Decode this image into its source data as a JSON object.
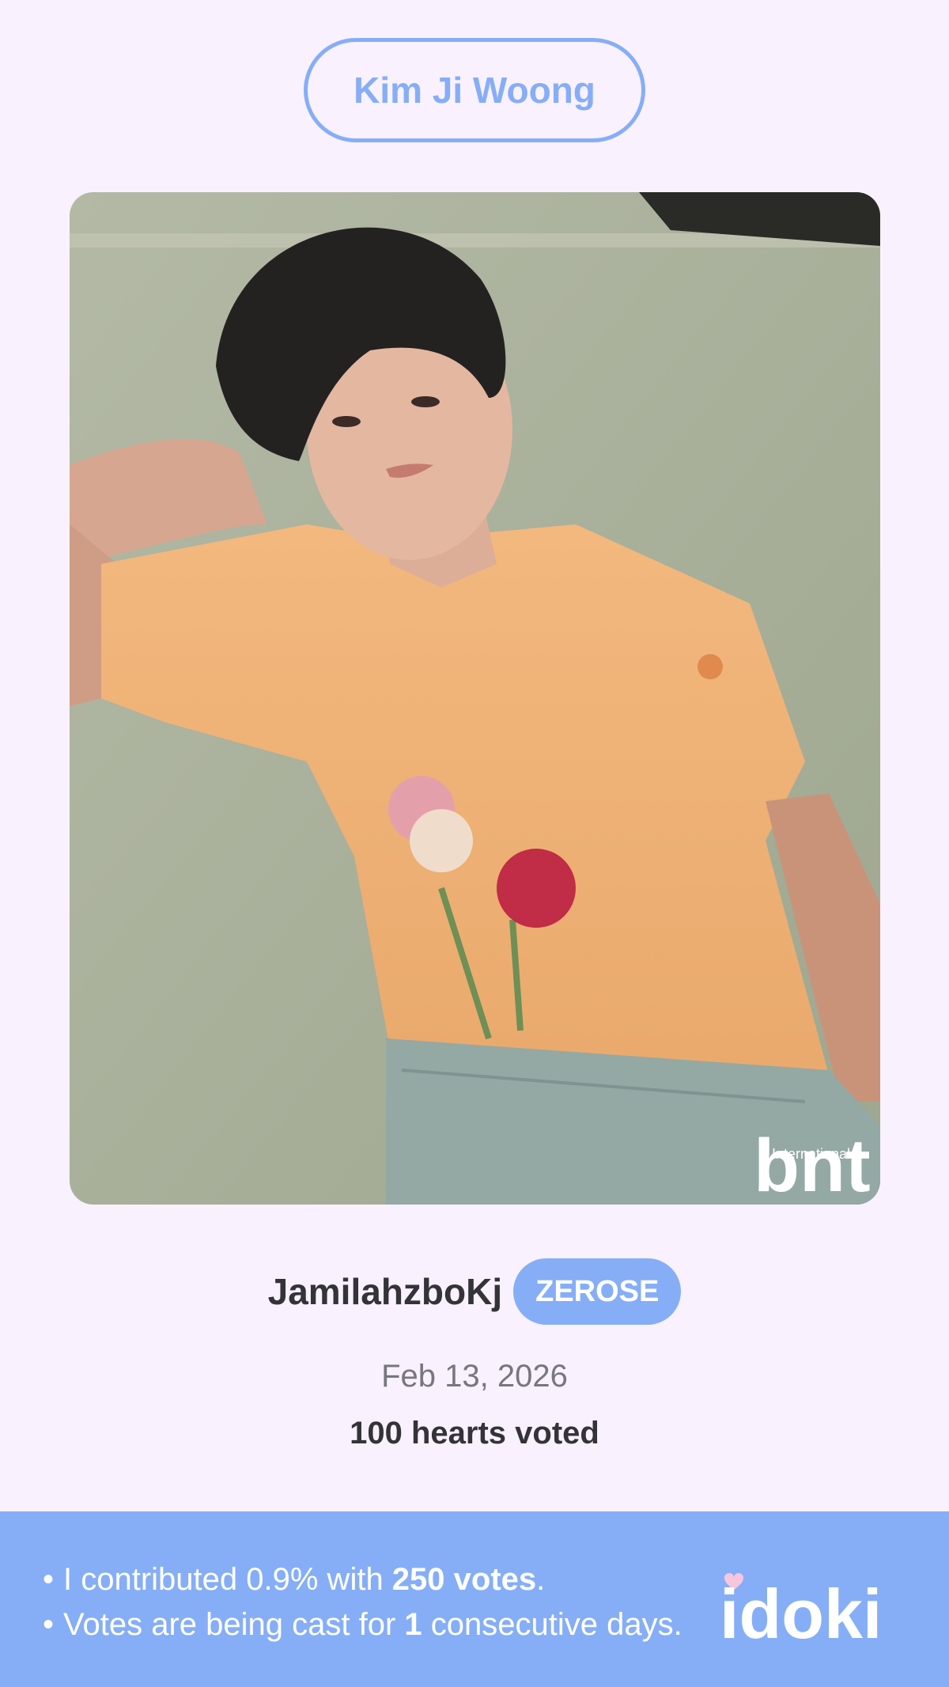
{
  "header": {
    "idol_name": "Kim Ji Woong"
  },
  "photo": {
    "watermark_small": "International",
    "watermark_big": "bnt"
  },
  "user": {
    "username": "JamilahzboKj",
    "fandom": "ZEROSE"
  },
  "vote": {
    "date": "Feb 13, 2026",
    "hearts_text": "100 hearts voted"
  },
  "footer": {
    "line1": {
      "prefix": "I contributed 0.9% with ",
      "bold": "250 votes",
      "suffix": "."
    },
    "line2": {
      "prefix": "Votes are being cast for ",
      "bold": "1",
      "suffix": " consecutive days."
    },
    "logo_text": "idoki"
  },
  "colors": {
    "accent": "#86aef6",
    "background": "#f9f1fd",
    "text_dark": "#333338",
    "text_muted": "#77777d"
  }
}
